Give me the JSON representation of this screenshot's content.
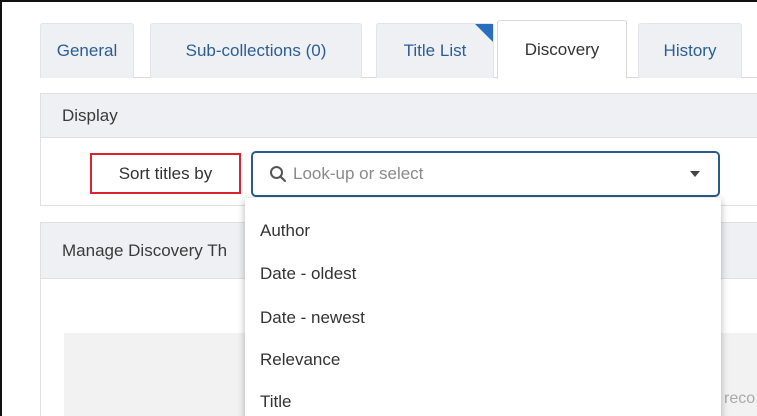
{
  "tabs": [
    {
      "label": "General"
    },
    {
      "label": "Sub-collections (0)"
    },
    {
      "label": "Title List"
    },
    {
      "label": "Discovery"
    },
    {
      "label": "History"
    }
  ],
  "display_section": {
    "header": "Display",
    "sort_label": "Sort titles by"
  },
  "sort_dropdown": {
    "placeholder": "Look-up or select",
    "value": "",
    "options": [
      "Author",
      "Date - oldest",
      "Date - newest",
      "Relevance",
      "Title"
    ]
  },
  "manage_section": {
    "header": "Manage Discovery Th"
  },
  "peek_text": "reco",
  "colors": {
    "link_blue": "#2b5d95",
    "highlight_red": "#d9232d",
    "focus_border": "#2a5a8a",
    "corner_marker": "#2a6fbd"
  }
}
